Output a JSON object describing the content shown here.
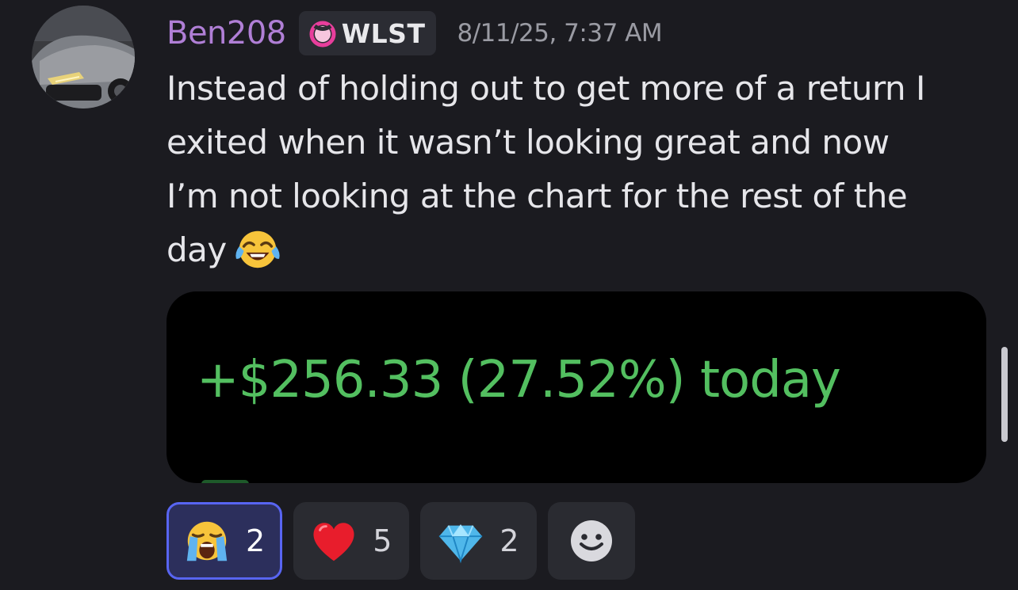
{
  "message": {
    "author": "Ben208",
    "tag": {
      "label": "WLST",
      "icon": "crescent-badge-icon",
      "color": "#e83e9c"
    },
    "timestamp": "8/11/25, 7:37 AM",
    "content_lines": [
      "Instead of holding out to get more of a return I",
      "exited when it wasn’t looking great and now",
      "I’m not looking at the chart for the rest of the",
      "day"
    ],
    "inline_emoji": "face-with-tears-of-joy-emoji",
    "attachment": {
      "text": "+$256.33 (27.52%) today",
      "text_color": "#53bf60"
    }
  },
  "reactions": [
    {
      "emoji": "loudly-crying-face-emoji",
      "count": "2",
      "active": true
    },
    {
      "emoji": "red-heart-emoji",
      "count": "5",
      "active": false
    },
    {
      "emoji": "gem-stone-emoji",
      "count": "2",
      "active": false
    }
  ],
  "add_reaction": {
    "icon": "smiley-add-reaction-icon"
  },
  "colors": {
    "background": "#1b1b20",
    "username": "#b07fd6",
    "active_reaction_border": "#5865f2"
  }
}
